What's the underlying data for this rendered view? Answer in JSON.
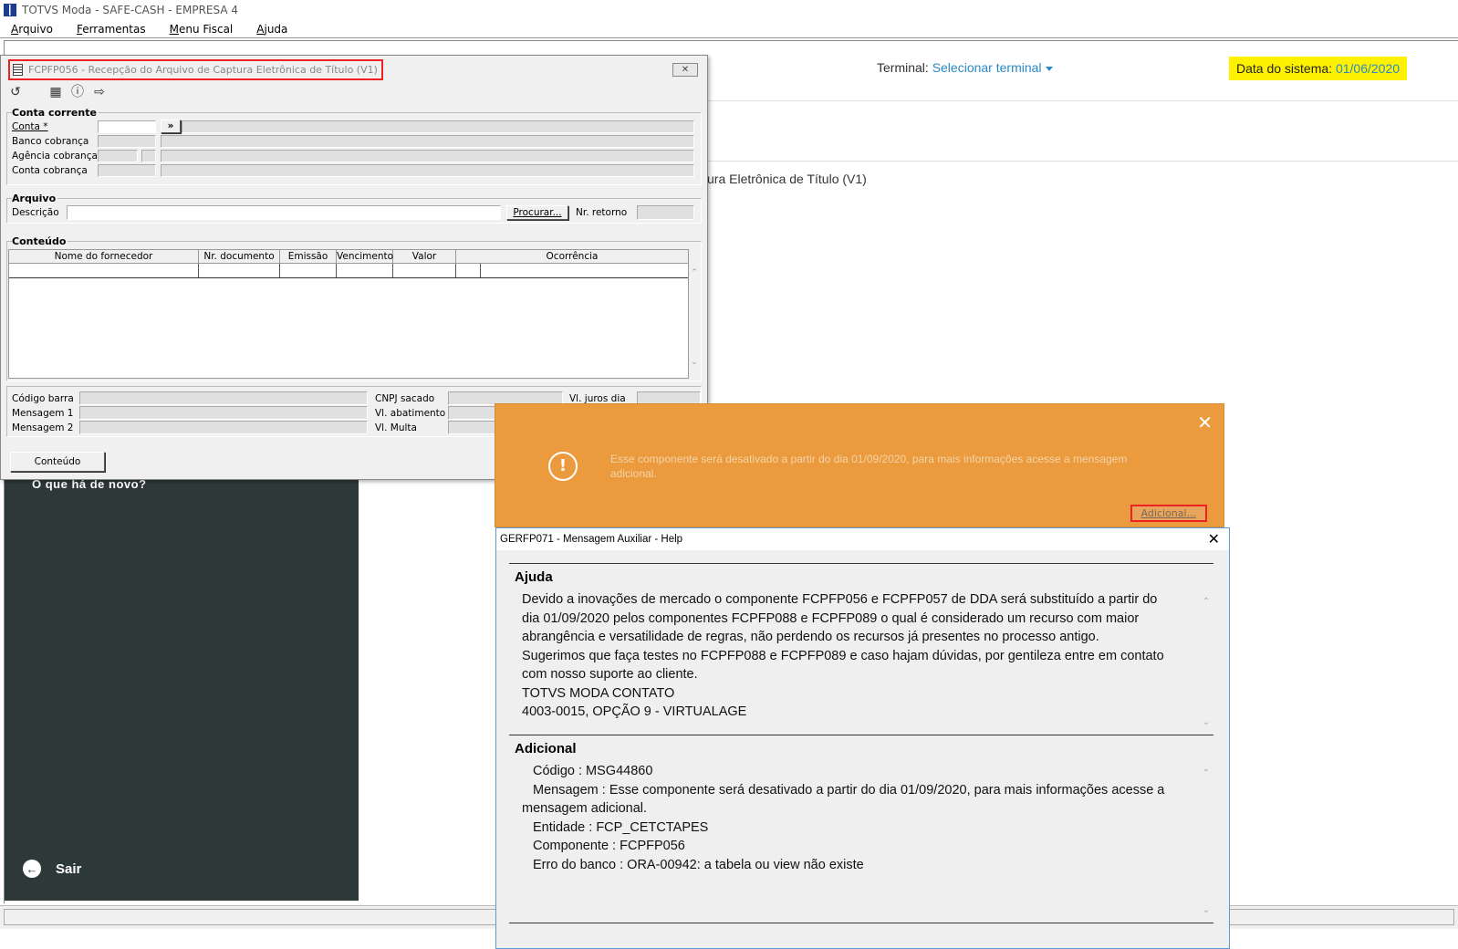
{
  "app": {
    "title": "TOTVS Moda - SAFE-CASH - EMPRESA 4"
  },
  "menu": [
    "Arquivo",
    "Ferramentas",
    "Menu Fiscal",
    "Ajuda"
  ],
  "header": {
    "terminal_label": "Terminal:",
    "terminal_link": "Selecionar terminal",
    "sysdate_label": "Data do sistema:",
    "sysdate_value": "01/06/2020"
  },
  "background": {
    "title_fragment": "ura Eletrônica de Título (V1)",
    "news": "O que há de novo?",
    "exit": "Sair"
  },
  "form": {
    "title": "FCPFP056 - Recepção do Arquivo de Captura Eletrônica de Título (V1)",
    "conta_corrente": {
      "legend": "Conta corrente",
      "conta": "Conta *",
      "banco": "Banco cobrança",
      "agencia": "Agência cobrança",
      "conta_cobranca": "Conta cobrança",
      "go": "»"
    },
    "arquivo": {
      "legend": "Arquivo",
      "descricao": "Descrição",
      "procurar": "Procurar...",
      "nr_retorno": "Nr. retorno"
    },
    "conteudo": {
      "legend": "Conteúdo",
      "columns": [
        "Nome do fornecedor",
        "Nr. documento",
        "Emissão",
        "Vencimento",
        "Valor",
        "Ocorrência"
      ]
    },
    "footer": {
      "codigo_barra": "Código barra",
      "mensagem1": "Mensagem 1",
      "mensagem2": "Mensagem 2",
      "cnpj": "CNPJ sacado",
      "abatimento": "Vl. abatimento",
      "multa": "Vl. Multa",
      "juros": "Vl. juros dia",
      "conteudo_btn": "Conteúdo"
    }
  },
  "warning": {
    "message": "Esse componente será desativado a partir do dia 01/09/2020, para mais informações acesse a mensagem adicional.",
    "button": "Adicional..."
  },
  "help": {
    "title": "GERFP071 - Mensagem Auxiliar - Help",
    "ajuda_heading": "Ajuda",
    "ajuda_lines": [
      "Devido a inovações de mercado o componente FCPFP056 e FCPFP057 de DDA será substituído a partir do",
      "dia 01/09/2020 pelos componentes FCPFP088 e FCPFP089  o qual é considerado um recurso com maior",
      "abrangência e versatilidade de regras, não perdendo os recursos já presentes no processo antigo.",
      "Sugerimos que faça testes no FCPFP088 e FCPFP089 e caso hajam dúvidas, por gentileza entre em contato",
      "com nosso suporte ao cliente.",
      "TOTVS MODA CONTATO",
      "4003-0015, OPÇÃO 9 - VIRTUALAGE"
    ],
    "adicional_heading": "Adicional",
    "adicional": {
      "codigo": "Código : MSG44860",
      "mensagem1": "Mensagem : Esse componente será desativado a partir do dia 01/09/2020, para mais informações acesse a",
      "mensagem2": "mensagem adicional.",
      "entidade": "Entidade : FCP_CETCTAPES",
      "componente": "Componente : FCPFP056",
      "erro": "Erro do banco : ORA-00942: a tabela ou view não existe"
    }
  }
}
